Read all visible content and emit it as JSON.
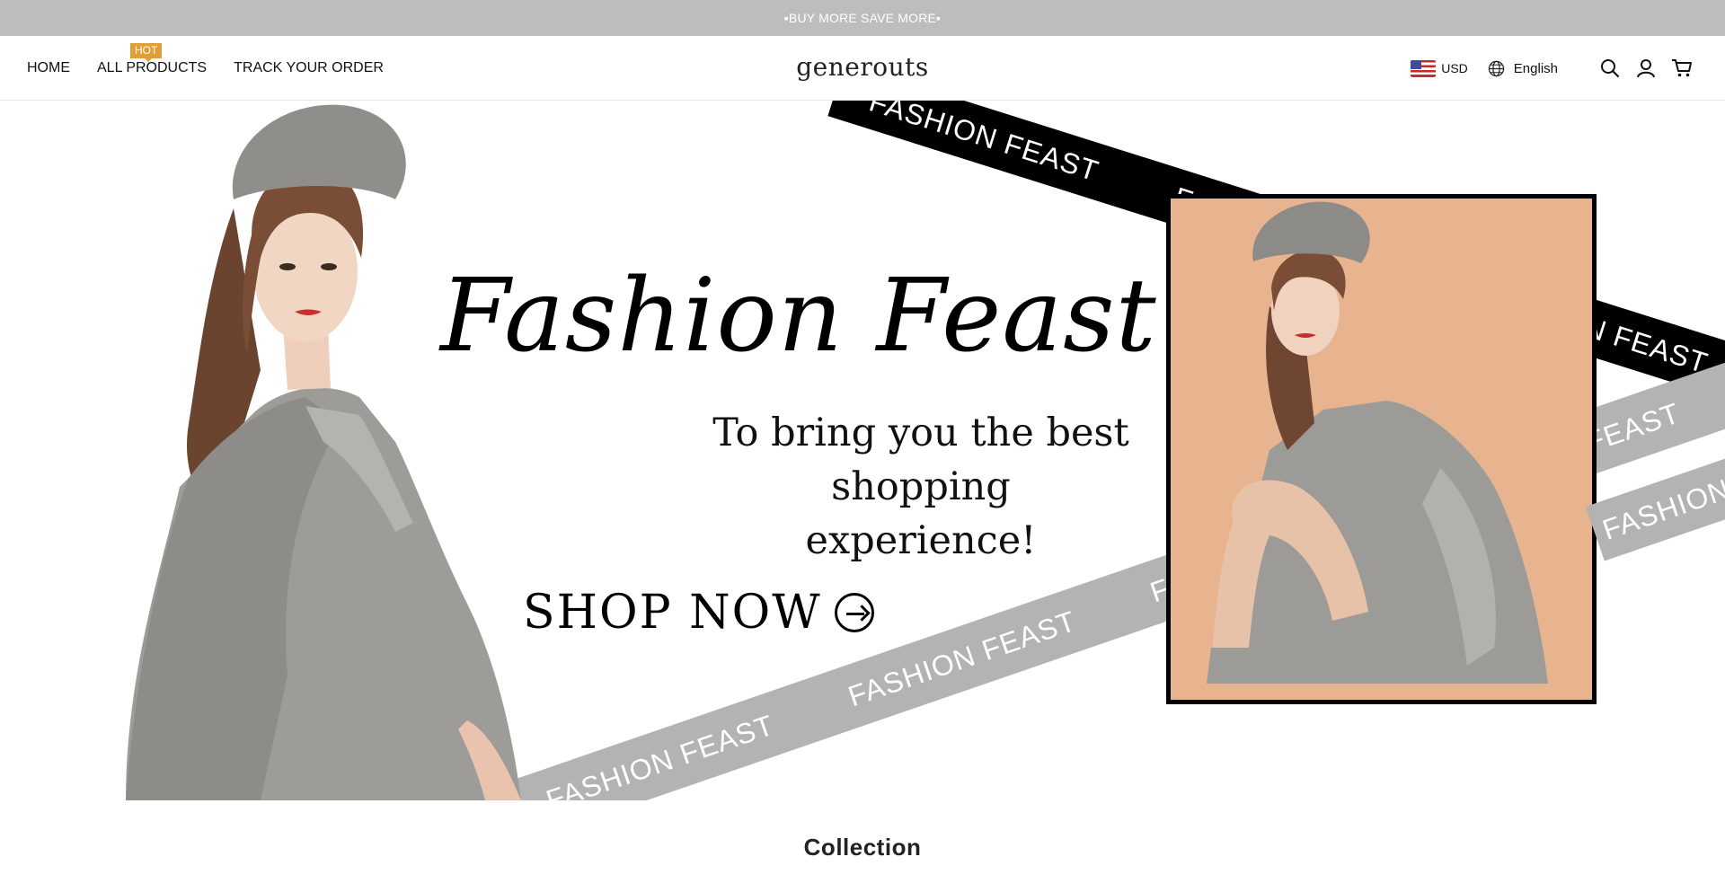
{
  "announcement": {
    "text": "▪BUY MORE SAVE MORE▪"
  },
  "nav": {
    "items": [
      {
        "label": "HOME"
      },
      {
        "label": "ALL PRODUCTS",
        "badge": "HOT"
      },
      {
        "label": "TRACK YOUR ORDER"
      }
    ]
  },
  "logo": {
    "text": "generouts"
  },
  "header_right": {
    "currency": "USD",
    "language": "English",
    "icons": [
      "search-icon",
      "account-icon",
      "cart-icon"
    ]
  },
  "hero": {
    "headline": "Fashion Feast.",
    "subline_1": "To bring you the best",
    "subline_2": "shopping experience!",
    "cta": "SHOP NOW",
    "band_text": "FASHION FEAST"
  },
  "section": {
    "title": "Collection"
  },
  "colors": {
    "announcement_bg": "#bdbdbd",
    "badge": "#e0a036",
    "photo_bg": "#e8b48f",
    "band_black": "#000000",
    "band_grey": "#b3b3b3"
  }
}
